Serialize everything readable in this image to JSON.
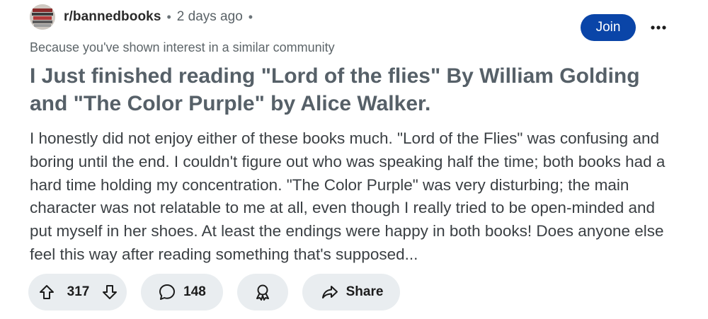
{
  "header": {
    "subreddit": "r/bannedbooks",
    "separator": "•",
    "time_ago": "2 days ago",
    "separator2": "•",
    "join_label": "Join"
  },
  "reason": "Because you've shown interest in a similar community",
  "post": {
    "title": "I Just finished reading \"Lord of the flies\" By William Golding and \"The Color Purple\" by Alice Walker.",
    "body": "I honestly did not enjoy either of these books much. \"Lord of the Flies\" was confusing and boring until the end. I couldn't figure out who was speaking half the time; both books had a hard time holding my concentration. \"The Color Purple\" was very disturbing; the main character was not relatable to me at all, even though I really tried to be open-minded and put myself in her shoes. At least the endings were happy in both books! Does anyone else feel this way after reading something that's supposed..."
  },
  "actions": {
    "vote_count": "317",
    "comment_count": "148",
    "share_label": "Share"
  },
  "icons": {
    "avatar": "subreddit-avatar",
    "upvote": "upvote-arrow-icon",
    "downvote": "downvote-arrow-icon",
    "comment": "speech-bubble-icon",
    "award": "award-ribbon-icon",
    "share": "share-arrow-icon",
    "more": "more-dots-icon"
  },
  "colors": {
    "join_button": "#0a45a8",
    "pill_background": "#e9edf0",
    "title_text": "#566068",
    "body_text": "#3a3f43",
    "meta_text": "#5d6569"
  }
}
